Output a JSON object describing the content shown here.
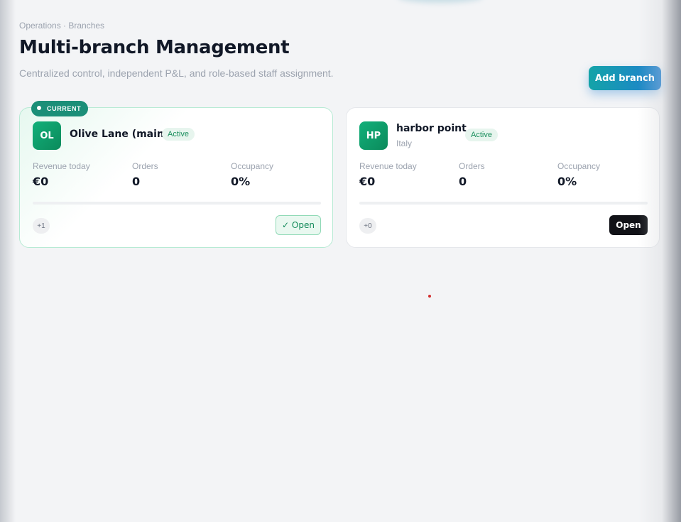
{
  "breadcrumb": "Operations · Branches",
  "page": {
    "title": "Multi-branch Management",
    "subtitle": "Centralized control, independent P&L, and role-based staff assignment."
  },
  "actions": {
    "add_branch_label": "Add branch"
  },
  "colors": {
    "accent_gradient_start": "#14a3a8",
    "accent_gradient_end": "#1f7fd0",
    "active_green": "#1b8f5e",
    "avatar_green": "#12b07a",
    "current_badge": "#1b8f78",
    "open_dark": "#111217"
  },
  "branches": [
    {
      "initials": "OL",
      "name": "Olive Lane (main)",
      "country": "",
      "status": "Active",
      "current_badge": "CURRENT",
      "revenue_label": "Revenue today",
      "revenue": "€0",
      "orders_label": "Orders",
      "orders": "0",
      "occupancy_label": "Occupancy",
      "occupancy": "0%",
      "occupancy_fraction": 0,
      "staff_count": "+1",
      "open_label": "✓ Open"
    },
    {
      "initials": "HP",
      "name": "harbor point",
      "country": "Italy",
      "status": "Active",
      "revenue_label": "Revenue today",
      "revenue": "€0",
      "orders_label": "Orders",
      "orders": "0",
      "occupancy_label": "Occupancy",
      "occupancy": "0%",
      "occupancy_fraction": 0,
      "staff_count": "+0",
      "open_label": "Open"
    }
  ]
}
